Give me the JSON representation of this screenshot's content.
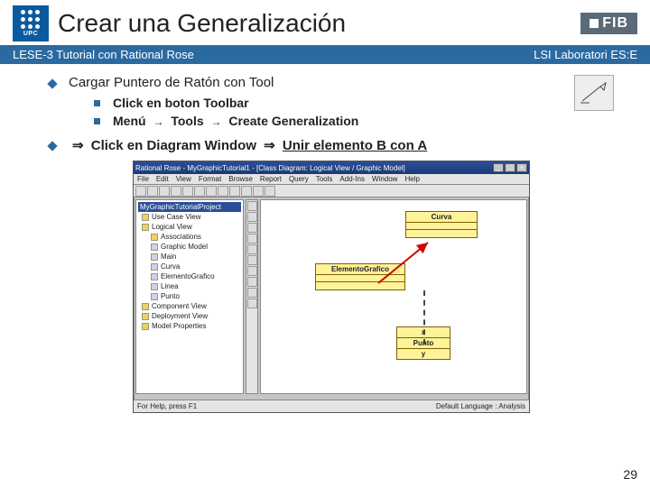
{
  "header": {
    "upc_label": "UPC",
    "title": "Crear una Generalización",
    "fib_label": "FIB"
  },
  "bar": {
    "left": "LESE-3 Tutorial con Rational Rose",
    "right": "LSI Laboratori ES:E"
  },
  "content": {
    "main1": "Cargar Puntero de Ratón con Tool",
    "sub1": "Click en boton Toolbar",
    "sub2_pre": "Menú",
    "sub2_mid": "Tools",
    "sub2_post": "Create Generalization",
    "main2_pre": "Click en Diagram Window",
    "main2_post": "Unir elemento B con A"
  },
  "rose": {
    "title": "Rational Rose - MyGraphicTutorial1 - [Class Diagram: Logical View / Graphic Model]",
    "menu": [
      "File",
      "Edit",
      "View",
      "Format",
      "Browse",
      "Report",
      "Query",
      "Tools",
      "Add-Ins",
      "Window",
      "Help"
    ],
    "tree_title": "MyGraphicTutorialProject",
    "tree": [
      {
        "label": "Use Case View",
        "cls": "pkg",
        "ind": 0
      },
      {
        "label": "Logical View",
        "cls": "pkg",
        "ind": 0
      },
      {
        "label": "Associations",
        "cls": "pkg",
        "ind": 1
      },
      {
        "label": "Graphic Model",
        "cls": "cls",
        "ind": 1
      },
      {
        "label": "Main",
        "cls": "cls",
        "ind": 1
      },
      {
        "label": "Curva",
        "cls": "cls",
        "ind": 1
      },
      {
        "label": "ElementoGrafico",
        "cls": "cls",
        "ind": 1
      },
      {
        "label": "Linea",
        "cls": "cls",
        "ind": 1
      },
      {
        "label": "Punto",
        "cls": "cls",
        "ind": 1
      },
      {
        "label": "Component View",
        "cls": "pkg",
        "ind": 0
      },
      {
        "label": "Deployment View",
        "cls": "pkg",
        "ind": 0
      },
      {
        "label": "Model Properties",
        "cls": "pkg",
        "ind": 0
      }
    ],
    "classA": "Curva",
    "classB": "ElementoGrafico",
    "classC_lines": [
      "x",
      "Punto",
      "y"
    ],
    "status_left": "For Help, press F1",
    "status_right": "Default Language : Analysis"
  },
  "page_number": "29"
}
